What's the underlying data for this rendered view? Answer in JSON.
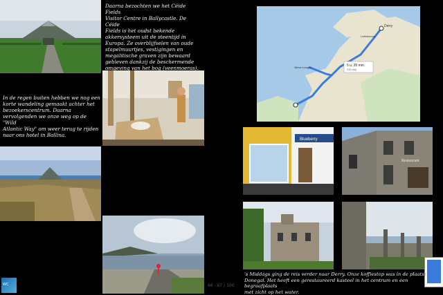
{
  "left_page": {
    "text_visitor_centre": "Daarna bezochten we het Céide Fields\nVisitor Centre in Ballycastle. De Céide\nFields is het oudst bekende\nakkersysteem uit de steentijd in\nEuropa. Ze overblijfselen van oude\nstapelmuurtjes, vestigingen en\nmegalitische graven zijn bewaard\ngebleven dankzij de beschermende\nomgeving van het bog (veenmoeras).",
    "text_walk": "In de regen buiten hebben we nog een\nkorte wandeling gemaakt achter het\nbezoekerscentrum. Daarna\nvervolgenden we onze weg op de \"Wild\nAtlantic Way\" om weer terug te rijden\nnaar ons hotel in Ballina."
  },
  "right_page": {
    "map": {
      "label_derry": "Derry",
      "label_letterkenny": "Letterkenny",
      "label_start": "Slieve League",
      "route_time": "5 u. 35 min.",
      "route_distance": "230 mijl"
    },
    "text_derry": "'s Middags ging de reis verder naar Derry. Onze koffiestop was in de plaats\nDonegal. Het heeft een gerestaureerd kasteel in het centrum en een begraafplaats\nmet zicht op het water.",
    "shop_sign": "Blueberry",
    "restaurant_sign": "Restaurant"
  },
  "footer": {
    "page_number": "66 - 67 / 100",
    "logo_text": "WC"
  },
  "colors": {
    "background": "#000000",
    "route": "#3b7bdc",
    "sea": "#a7c9e8",
    "land": "#e8e4d0"
  }
}
